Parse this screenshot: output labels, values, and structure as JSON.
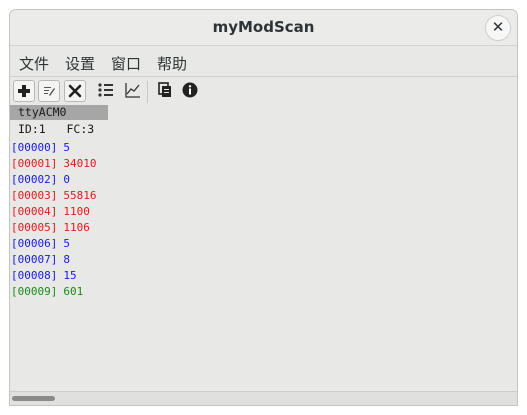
{
  "window": {
    "title": "myModScan",
    "close_glyph": "✕"
  },
  "menu": [
    {
      "label": "文件"
    },
    {
      "label": "设置"
    },
    {
      "label": "窗口"
    },
    {
      "label": "帮助"
    }
  ],
  "toolbar": {
    "icons": [
      "plus-icon",
      "edit-icon",
      "close-x-icon",
      "list-icon",
      "chart-icon",
      "copy-icon",
      "info-icon"
    ]
  },
  "device": {
    "port": "ttyACM0",
    "id_text": "ID:1",
    "fc_text": "FC:3"
  },
  "registers": [
    {
      "address": "[00000]",
      "value": "5",
      "color": "#1a1adc"
    },
    {
      "address": "[00001]",
      "value": "34010",
      "color": "#e01b1b"
    },
    {
      "address": "[00002]",
      "value": "0",
      "color": "#1a1adc"
    },
    {
      "address": "[00003]",
      "value": "55816",
      "color": "#e01b1b"
    },
    {
      "address": "[00004]",
      "value": "1100",
      "color": "#e01b1b"
    },
    {
      "address": "[00005]",
      "value": "1106",
      "color": "#e01b1b"
    },
    {
      "address": "[00006]",
      "value": "5",
      "color": "#1a1adc"
    },
    {
      "address": "[00007]",
      "value": "8",
      "color": "#1a1adc"
    },
    {
      "address": "[00008]",
      "value": "15",
      "color": "#1a1adc"
    },
    {
      "address": "[00009]",
      "value": "601",
      "color": "#1b8a1b"
    }
  ]
}
